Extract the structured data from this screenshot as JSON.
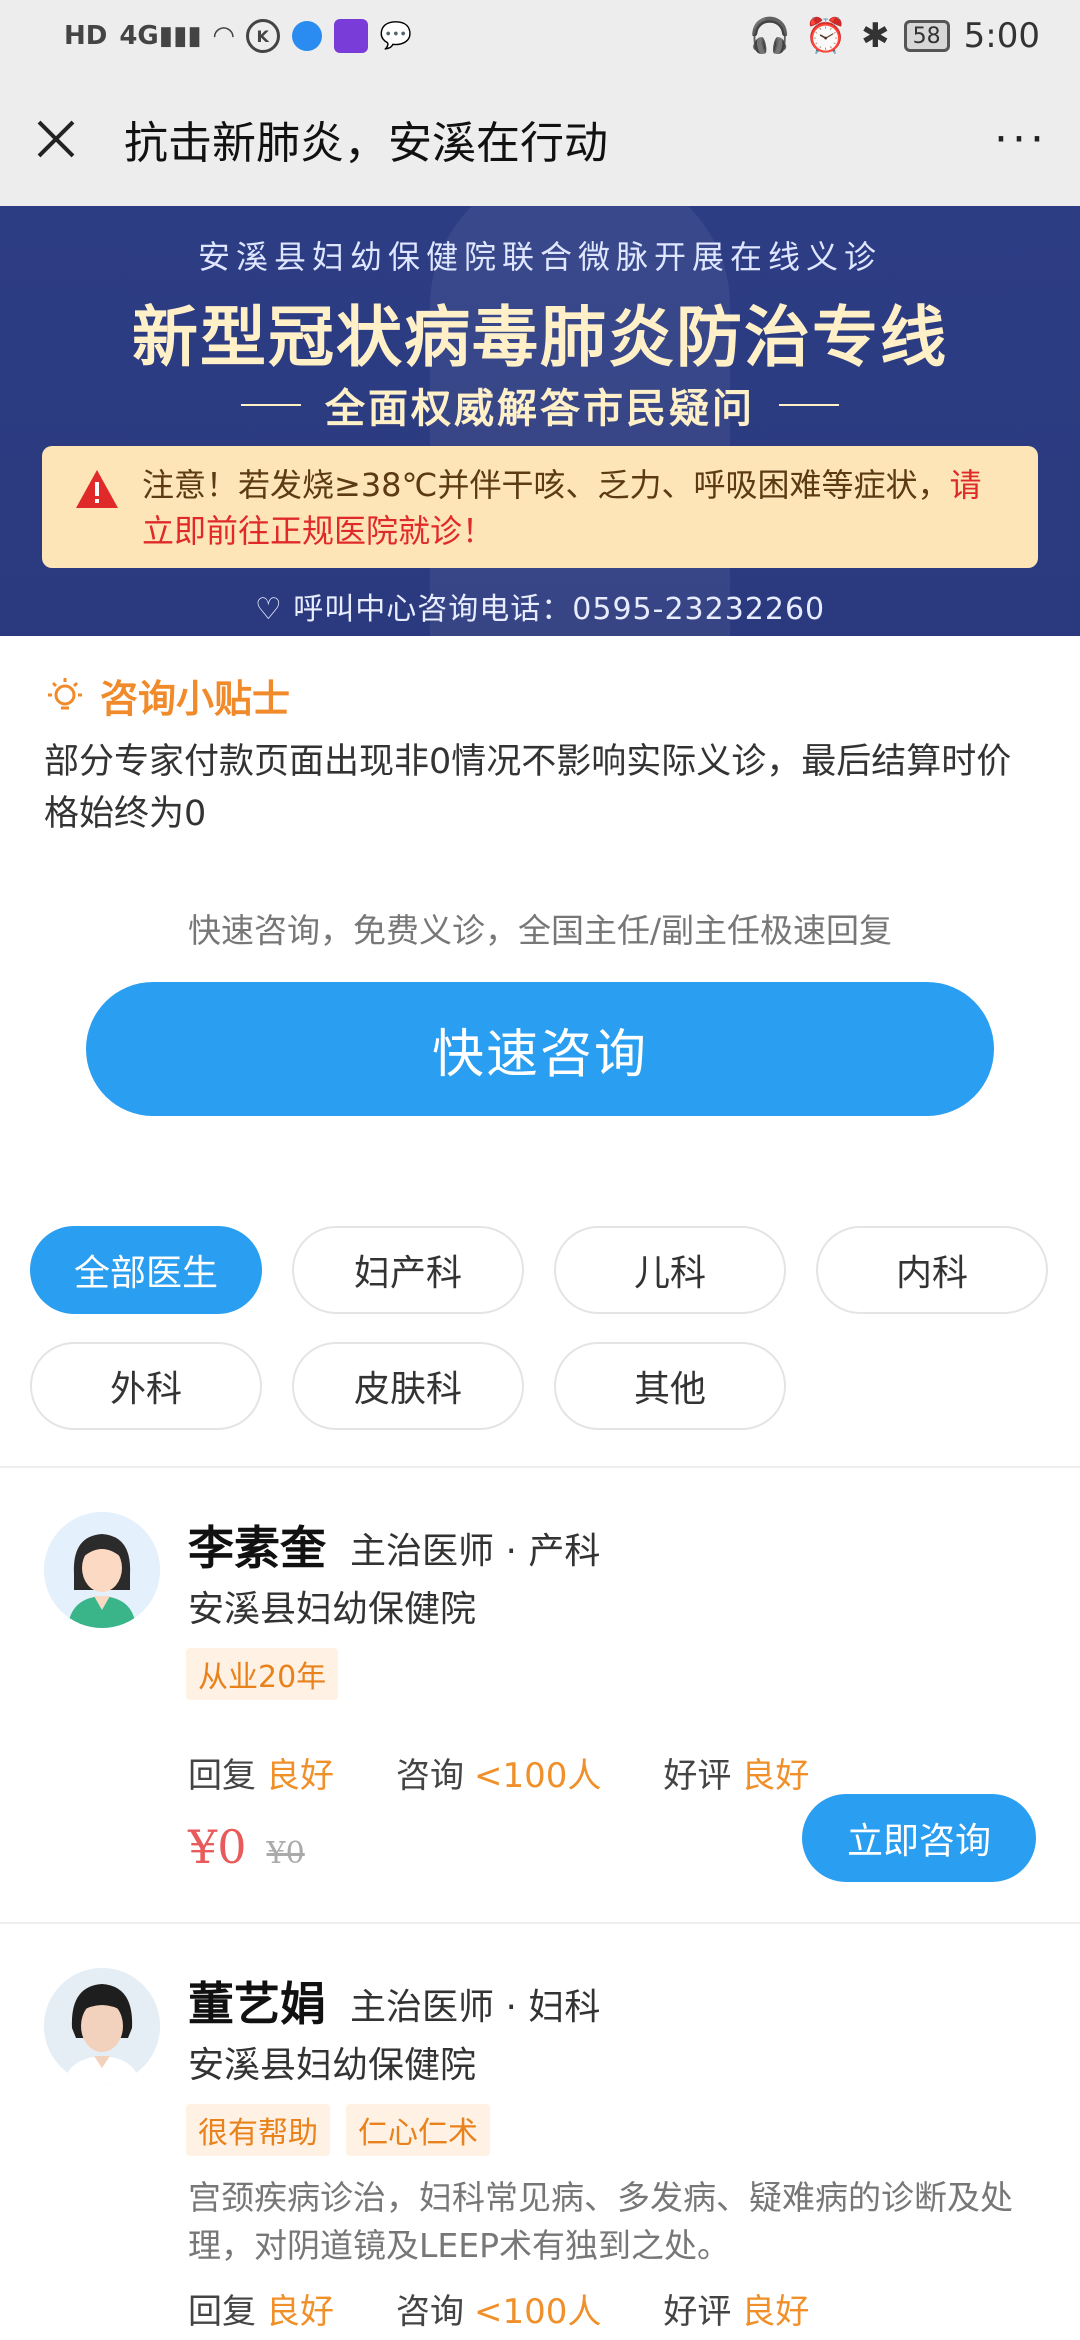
{
  "status_bar": {
    "time": "5:00",
    "battery": "58",
    "hd": "HD",
    "network": "4G",
    "k_label": "K"
  },
  "nav": {
    "title": "抗击新肺炎，安溪在行动",
    "more": "···"
  },
  "banner": {
    "subtitle": "安溪县妇幼保健院联合微脉开展在线义诊",
    "title": "新型冠状病毒肺炎防治专线",
    "tagline": "全面权威解答市民疑问",
    "notice_prefix": "注意！若发烧≥38℃并伴干咳、乏力、呼吸困难等症状，",
    "notice_highlight": "请立即前往正规医院就诊！",
    "phone": "呼叫中心咨询电话：0595-23232260"
  },
  "tips": {
    "title": "咨询小贴士",
    "body": "部分专家付款页面出现非0情况不影响实际义诊，最后结算时价格始终为0"
  },
  "quick": {
    "subtitle": "快速咨询，免费义诊，全国主任/副主任极速回复",
    "button": "快速咨询"
  },
  "filters": [
    "全部医生",
    "妇产科",
    "儿科",
    "内科",
    "外科",
    "皮肤科",
    "其他"
  ],
  "doctors": [
    {
      "name": "李素奎",
      "title": "主治医师 · 产科",
      "hospital": "安溪县妇幼保健院",
      "tags": [
        "从业20年"
      ],
      "desc": "",
      "reply_label": "回复",
      "reply_value": "良好",
      "consult_label": "咨询",
      "consult_value": "<100人",
      "rating_label": "好评",
      "rating_value": "良好",
      "price": "¥0",
      "old_price": "¥0",
      "button": "立即咨询"
    },
    {
      "name": "董艺娟",
      "title": "主治医师 · 妇科",
      "hospital": "安溪县妇幼保健院",
      "tags": [
        "很有帮助",
        "仁心仁术"
      ],
      "desc": "宫颈疾病诊治，妇科常见病、多发病、疑难病的诊断及处理，对阴道镜及LEEP术有独到之处。",
      "reply_label": "回复",
      "reply_value": "良好",
      "consult_label": "咨询",
      "consult_value": "<100人",
      "rating_label": "好评",
      "rating_value": "良好"
    }
  ],
  "colors": {
    "accent": "#2a9ef0",
    "orange": "#f0902a",
    "banner_bg": "#2d3d84",
    "price_red": "#e95b5b"
  }
}
